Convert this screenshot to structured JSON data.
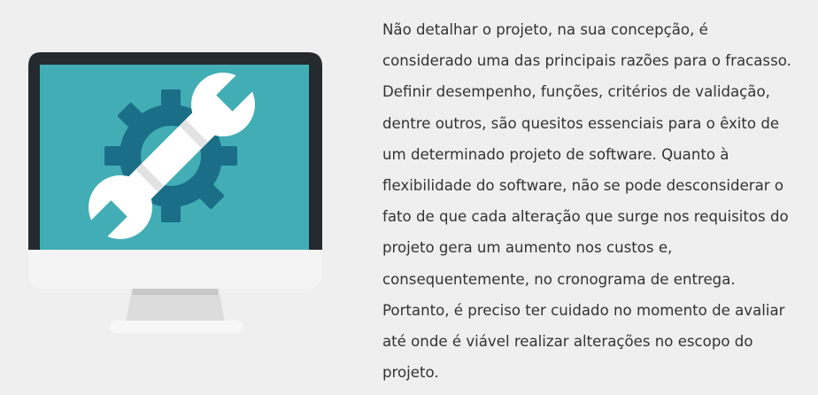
{
  "illustration": {
    "icon": "computer-monitor-with-wrench-and-gear-icon",
    "colors": {
      "screen": "#42adb5",
      "bezel": "#252a2e",
      "chin": "#f4f4f4",
      "stand": "#dcdcdc",
      "gear": "#1a6e87",
      "wrench": "#ffffff"
    }
  },
  "article": {
    "lines": [
      "Não detalhar o projeto, na sua concepção, é",
      "considerado uma das principais razões para o fracasso.",
      "Definir desempenho, funções, critérios de validação,",
      "dentre outros, são quesitos essenciais para o êxito de",
      "um determinado projeto de software. Quanto à",
      "flexibilidade do software, não se pode desconsiderar o",
      "fato de que cada alteração que surge nos requisitos do",
      "projeto gera um aumento nos custos e,",
      "consequentemente, no cronograma de entrega.",
      "Portanto, é preciso ter cuidado no momento de avaliar",
      "até onde é viável realizar alterações no escopo do",
      "projeto."
    ]
  }
}
